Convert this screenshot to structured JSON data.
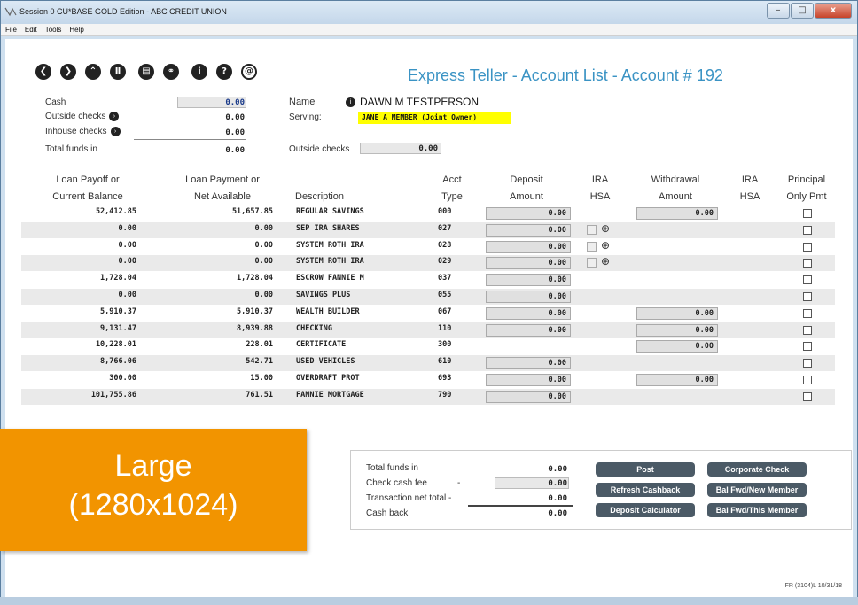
{
  "window": {
    "title": "Session 0 CU*BASE GOLD Edition - ABC CREDIT UNION",
    "minimize": "–",
    "maximize": "□",
    "close": "x"
  },
  "menu": [
    "File",
    "Edit",
    "Tools",
    "Help"
  ],
  "toolbar": {
    "icons": [
      "back-icon",
      "forward-icon",
      "up-icon",
      "pause-icon",
      "print-icon",
      "link-icon",
      "info-icon",
      "help-icon",
      "at-icon"
    ],
    "glyphs": [
      "❮",
      "❯",
      "⌃",
      "Ⅱ",
      "▤",
      "⚭",
      "i",
      "?",
      "@"
    ]
  },
  "page_title": "Express Teller - Account List - Account # 192",
  "funds": {
    "cash_label": "Cash",
    "cash_value": "0.00",
    "outside_label": "Outside checks",
    "outside_value": "0.00",
    "inhouse_label": "Inhouse checks",
    "inhouse_value": "0.00",
    "total_label": "Total funds in",
    "total_value": "0.00"
  },
  "member": {
    "name_label": "Name",
    "name_value": "DAWN M TESTPERSON",
    "serving_label": "Serving:",
    "serving_value": "JANE A MEMBER (Joint Owner)",
    "outside_label": "Outside checks",
    "outside_value": "0.00"
  },
  "columns": {
    "loan_payoff": [
      "Loan Payoff or",
      "Current Balance"
    ],
    "loan_payment": [
      "Loan Payment or",
      "Net Available"
    ],
    "description": "Description",
    "acct_type": [
      "Acct",
      "Type"
    ],
    "deposit": [
      "Deposit",
      "Amount"
    ],
    "ira_hsa": [
      "IRA",
      "HSA"
    ],
    "withdrawal": [
      "Withdrawal",
      "Amount"
    ],
    "ira_hsa2": [
      "IRA",
      "HSA"
    ],
    "principal": [
      "Principal",
      "Only Pmt"
    ]
  },
  "rows": [
    {
      "balance": "52,412.85",
      "net": "51,657.85",
      "desc": "REGULAR SAVINGS",
      "type": "000",
      "deposit": "0.00",
      "ira": false,
      "withdrawal": "0.00"
    },
    {
      "balance": "0.00",
      "net": "0.00",
      "desc": "SEP IRA SHARES",
      "type": "027",
      "deposit": "0.00",
      "ira": true,
      "withdrawal": null
    },
    {
      "balance": "0.00",
      "net": "0.00",
      "desc": "SYSTEM ROTH IRA",
      "type": "028",
      "deposit": "0.00",
      "ira": true,
      "withdrawal": null
    },
    {
      "balance": "0.00",
      "net": "0.00",
      "desc": "SYSTEM ROTH IRA",
      "type": "029",
      "deposit": "0.00",
      "ira": true,
      "withdrawal": null
    },
    {
      "balance": "1,728.04",
      "net": "1,728.04",
      "desc": "ESCROW FANNIE M",
      "type": "037",
      "deposit": "0.00",
      "ira": false,
      "withdrawal": null
    },
    {
      "balance": "0.00",
      "net": "0.00",
      "desc": "SAVINGS PLUS",
      "type": "055",
      "deposit": "0.00",
      "ira": false,
      "withdrawal": null
    },
    {
      "balance": "5,910.37",
      "net": "5,910.37",
      "desc": "WEALTH BUILDER",
      "type": "067",
      "deposit": "0.00",
      "ira": false,
      "withdrawal": "0.00"
    },
    {
      "balance": "9,131.47",
      "net": "8,939.88",
      "desc": "CHECKING",
      "type": "110",
      "deposit": "0.00",
      "ira": false,
      "withdrawal": "0.00"
    },
    {
      "balance": "10,228.01",
      "net": "228.01",
      "desc": "CERTIFICATE",
      "type": "300",
      "deposit": null,
      "ira": false,
      "withdrawal": "0.00"
    },
    {
      "balance": "8,766.06",
      "net": "542.71",
      "desc": "USED VEHICLES",
      "type": "610",
      "deposit": "0.00",
      "ira": false,
      "withdrawal": null
    },
    {
      "balance": "300.00",
      "net": "15.00",
      "desc": "OVERDRAFT PROT",
      "type": "693",
      "deposit": "0.00",
      "ira": false,
      "withdrawal": "0.00"
    },
    {
      "balance": "101,755.86",
      "net": "761.51",
      "desc": "FANNIE MORTGAGE",
      "type": "790",
      "deposit": "0.00",
      "ira": false,
      "withdrawal": null
    }
  ],
  "summary": {
    "total_label": "Total funds in",
    "total_value": "0.00",
    "fee_label": "Check cash fee",
    "fee_dash": "-",
    "fee_value": "0.00",
    "net_label": "Transaction net total -",
    "net_value": "0.00",
    "cashback_label": "Cash back",
    "cashback_value": "0.00"
  },
  "buttons": {
    "post": "Post",
    "corporate_check": "Corporate Check",
    "refresh_cashback": "Refresh Cashback",
    "bal_fwd_new": "Bal Fwd/New Member",
    "deposit_calc": "Deposit Calculator",
    "bal_fwd_this": "Bal Fwd/This Member"
  },
  "badge": {
    "line1": "Large",
    "line2": "(1280x1024)"
  },
  "footer": "FR (3104)L 10/31/18",
  "colors": {
    "accent": "#3a93c4",
    "badge": "#f29400",
    "button": "#4b5a66",
    "highlight": "#ffff00"
  }
}
